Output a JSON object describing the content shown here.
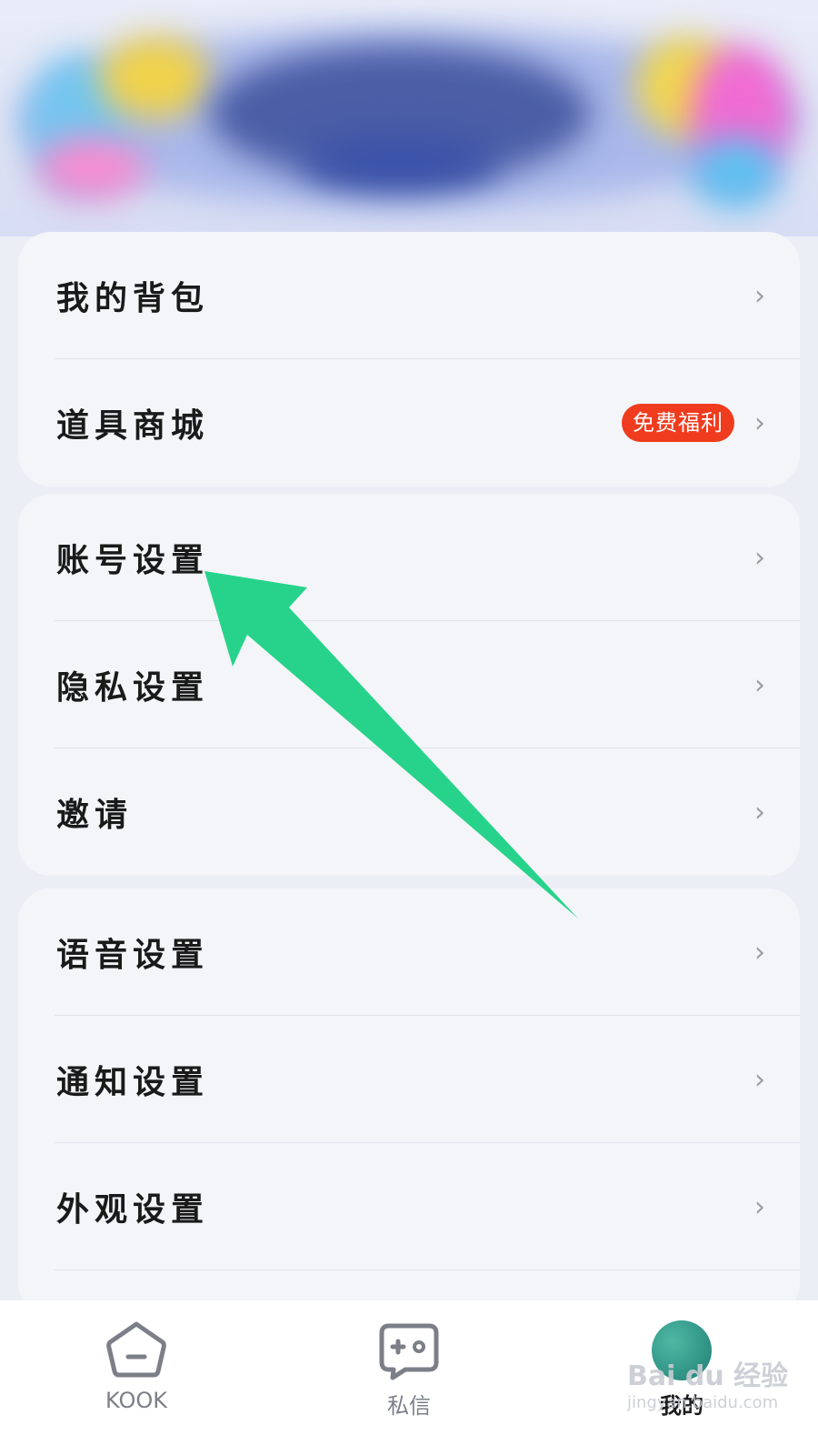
{
  "banner": {
    "description_icon": "blurred-promo-banner"
  },
  "menu": {
    "group1": [
      {
        "label": "我的背包"
      },
      {
        "label": "道具商城",
        "badge": "免费福利"
      }
    ],
    "group2": [
      {
        "label": "账号设置"
      },
      {
        "label": "隐私设置"
      },
      {
        "label": "邀请"
      }
    ],
    "group3": [
      {
        "label": "语音设置"
      },
      {
        "label": "通知设置"
      },
      {
        "label": "外观设置"
      }
    ],
    "chevron": "›"
  },
  "tabbar": {
    "tabs": [
      {
        "label": "KOOK",
        "icon": "home-icon"
      },
      {
        "label": "私信",
        "icon": "gamepad-chat-icon"
      },
      {
        "label": "我的",
        "icon": "avatar"
      }
    ]
  },
  "annotation": {
    "arrow_color": "#27d38a"
  },
  "watermark": {
    "line1": "Bai du 经验",
    "line2": "jingyan.baidu.com"
  },
  "colors": {
    "badge": "#f03c1e",
    "background": "#eceef5",
    "card": "#f3f5f9"
  }
}
